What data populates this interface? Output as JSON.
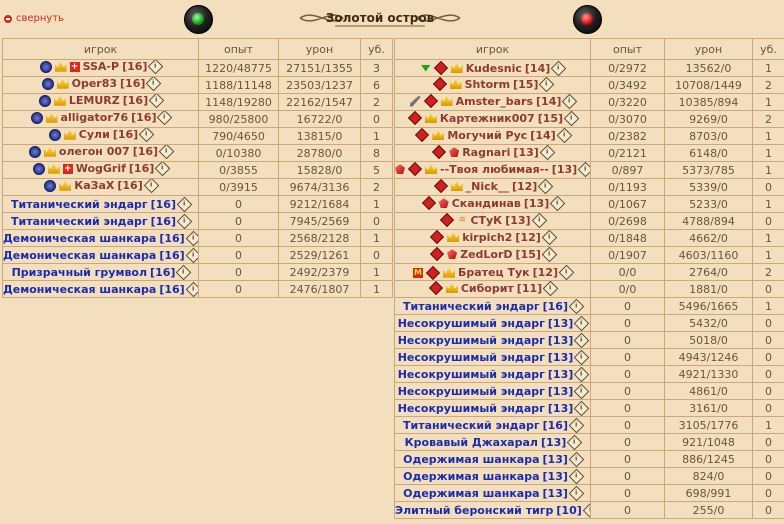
{
  "collapse_label": "свернуть",
  "title": "Золотой остров",
  "headers": {
    "player": "игрок",
    "exp": "опыт",
    "dmg": "урон",
    "kills": "уб."
  },
  "left_team": [
    {
      "name": "SSA-P",
      "level": "[16]",
      "exp": "1220/48775",
      "dmg": "27151/1355",
      "kills": "3",
      "bot": false,
      "icons": [
        "align-circle",
        "crown",
        "badge-plus",
        "info"
      ]
    },
    {
      "name": "Oper83",
      "level": "[16]",
      "exp": "1188/11148",
      "dmg": "23503/1237",
      "kills": "6",
      "bot": false,
      "icons": [
        "align-circle",
        "crown",
        "info"
      ]
    },
    {
      "name": "LEMURZ",
      "level": "[16]",
      "exp": "1148/19280",
      "dmg": "22162/1547",
      "kills": "2",
      "bot": false,
      "icons": [
        "align-circle",
        "crown",
        "info"
      ]
    },
    {
      "name": "alligator76",
      "level": "[16]",
      "exp": "980/25800",
      "dmg": "16722/0",
      "kills": "0",
      "bot": false,
      "icons": [
        "align-circle",
        "crown",
        "info"
      ]
    },
    {
      "name": "Сули",
      "level": "[16]",
      "exp": "790/4650",
      "dmg": "13815/0",
      "kills": "1",
      "bot": false,
      "icons": [
        "align-circle",
        "crown",
        "info"
      ]
    },
    {
      "name": "олегон 007",
      "level": "[16]",
      "exp": "0/10380",
      "dmg": "28780/0",
      "kills": "8",
      "bot": false,
      "icons": [
        "align-circle",
        "crown",
        "info"
      ]
    },
    {
      "name": "WogGrif",
      "level": "[16]",
      "exp": "0/3855",
      "dmg": "15828/0",
      "kills": "5",
      "bot": false,
      "icons": [
        "align-circle",
        "crown",
        "badge-plus",
        "info"
      ]
    },
    {
      "name": "КаЗаХ",
      "level": "[16]",
      "exp": "0/3915",
      "dmg": "9674/3136",
      "kills": "2",
      "bot": false,
      "icons": [
        "align-circle",
        "crown",
        "info"
      ]
    },
    {
      "name": "Титанический эндарг",
      "level": "[16]",
      "exp": "0",
      "dmg": "9212/1684",
      "kills": "1",
      "bot": true,
      "icons": [
        "info"
      ]
    },
    {
      "name": "Титанический эндарг",
      "level": "[16]",
      "exp": "0",
      "dmg": "7945/2569",
      "kills": "0",
      "bot": true,
      "icons": [
        "info"
      ]
    },
    {
      "name": "Демоническая шанкара",
      "level": "[16]",
      "exp": "0",
      "dmg": "2568/2128",
      "kills": "1",
      "bot": true,
      "icons": [
        "info"
      ]
    },
    {
      "name": "Демоническая шанкара",
      "level": "[16]",
      "exp": "0",
      "dmg": "2529/1261",
      "kills": "0",
      "bot": true,
      "icons": [
        "info"
      ]
    },
    {
      "name": "Призрачный грумвол",
      "level": "[16]",
      "exp": "0",
      "dmg": "2492/2379",
      "kills": "1",
      "bot": true,
      "icons": [
        "info"
      ]
    },
    {
      "name": "Демоническая шанкара",
      "level": "[16]",
      "exp": "0",
      "dmg": "2476/1807",
      "kills": "1",
      "bot": true,
      "icons": [
        "info"
      ]
    }
  ],
  "right_team": [
    {
      "name": "Kudesnic",
      "level": "[14]",
      "exp": "0/2972",
      "dmg": "13562/0",
      "kills": "1",
      "bot": false,
      "icons": [
        "align-green",
        "align-diamond",
        "crown",
        "info"
      ]
    },
    {
      "name": "Shtorm",
      "level": "[15]",
      "exp": "0/3492",
      "dmg": "10708/1449",
      "kills": "2",
      "bot": false,
      "icons": [
        "align-diamond",
        "crown",
        "info"
      ]
    },
    {
      "name": "Amster_bars",
      "level": "[14]",
      "exp": "0/3220",
      "dmg": "10385/894",
      "kills": "1",
      "bot": false,
      "icons": [
        "brush",
        "align-diamond",
        "crown",
        "info"
      ]
    },
    {
      "name": "Картежник007",
      "level": "[15]",
      "exp": "0/3070",
      "dmg": "9269/0",
      "kills": "2",
      "bot": false,
      "icons": [
        "align-diamond",
        "crown",
        "info"
      ]
    },
    {
      "name": "Могучий Рус",
      "level": "[14]",
      "exp": "0/2382",
      "dmg": "8703/0",
      "kills": "1",
      "bot": false,
      "icons": [
        "align-diamond",
        "crown",
        "info"
      ]
    },
    {
      "name": "Ragnari",
      "level": "[13]",
      "exp": "0/2121",
      "dmg": "6148/0",
      "kills": "1",
      "bot": false,
      "icons": [
        "align-diamond",
        "gem-red",
        "info"
      ]
    },
    {
      "name": "--Твоя любимая--",
      "level": "[13]",
      "exp": "0/897",
      "dmg": "5373/785",
      "kills": "1",
      "bot": false,
      "icons": [
        "gem-red",
        "align-diamond",
        "crown",
        "info"
      ]
    },
    {
      "name": "_Nick__",
      "level": "[12]",
      "exp": "0/1193",
      "dmg": "5339/0",
      "kills": "0",
      "bot": false,
      "icons": [
        "align-diamond",
        "crown",
        "info"
      ]
    },
    {
      "name": "Скандинав",
      "level": "[13]",
      "exp": "0/1067",
      "dmg": "5233/0",
      "kills": "1",
      "bot": false,
      "icons": [
        "align-diamond",
        "gem-red",
        "info"
      ]
    },
    {
      "name": "СТуК",
      "level": "[13]",
      "exp": "0/2698",
      "dmg": "4788/894",
      "kills": "0",
      "bot": false,
      "icons": [
        "align-diamond",
        "wifi",
        "info"
      ]
    },
    {
      "name": "kirpich2",
      "level": "[12]",
      "exp": "0/1848",
      "dmg": "4662/0",
      "kills": "1",
      "bot": false,
      "icons": [
        "align-diamond",
        "crown",
        "info"
      ]
    },
    {
      "name": "ZedLorD",
      "level": "[15]",
      "exp": "0/1907",
      "dmg": "4603/1160",
      "kills": "1",
      "bot": false,
      "icons": [
        "align-diamond",
        "gem-red",
        "info"
      ]
    },
    {
      "name": "Братец Тук",
      "level": "[12]",
      "exp": "0/0",
      "dmg": "2764/0",
      "kills": "2",
      "bot": false,
      "icons": [
        "badge-m",
        "align-diamond",
        "crown",
        "info"
      ]
    },
    {
      "name": "Сиборит",
      "level": "[11]",
      "exp": "0/0",
      "dmg": "1881/0",
      "kills": "0",
      "bot": false,
      "icons": [
        "align-diamond",
        "crown",
        "info"
      ]
    },
    {
      "name": "Титанический эндарг",
      "level": "[16]",
      "exp": "0",
      "dmg": "5496/1665",
      "kills": "1",
      "bot": true,
      "icons": [
        "info"
      ]
    },
    {
      "name": "Несокрушимый эндарг",
      "level": "[13]",
      "exp": "0",
      "dmg": "5432/0",
      "kills": "0",
      "bot": true,
      "icons": [
        "info"
      ]
    },
    {
      "name": "Несокрушимый эндарг",
      "level": "[13]",
      "exp": "0",
      "dmg": "5018/0",
      "kills": "0",
      "bot": true,
      "icons": [
        "info"
      ]
    },
    {
      "name": "Несокрушимый эндарг",
      "level": "[13]",
      "exp": "0",
      "dmg": "4943/1246",
      "kills": "0",
      "bot": true,
      "icons": [
        "info"
      ]
    },
    {
      "name": "Несокрушимый эндарг",
      "level": "[13]",
      "exp": "0",
      "dmg": "4921/1330",
      "kills": "0",
      "bot": true,
      "icons": [
        "info"
      ]
    },
    {
      "name": "Несокрушимый эндарг",
      "level": "[13]",
      "exp": "0",
      "dmg": "4861/0",
      "kills": "0",
      "bot": true,
      "icons": [
        "info"
      ]
    },
    {
      "name": "Несокрушимый эндарг",
      "level": "[13]",
      "exp": "0",
      "dmg": "3161/0",
      "kills": "0",
      "bot": true,
      "icons": [
        "info"
      ]
    },
    {
      "name": "Титанический эндарг",
      "level": "[16]",
      "exp": "0",
      "dmg": "3105/1776",
      "kills": "1",
      "bot": true,
      "icons": [
        "info"
      ]
    },
    {
      "name": "Кровавый Джахарал",
      "level": "[13]",
      "exp": "0",
      "dmg": "921/1048",
      "kills": "0",
      "bot": true,
      "icons": [
        "info"
      ]
    },
    {
      "name": "Одержимая шанкара",
      "level": "[13]",
      "exp": "0",
      "dmg": "886/1245",
      "kills": "0",
      "bot": true,
      "icons": [
        "info"
      ]
    },
    {
      "name": "Одержимая шанкара",
      "level": "[13]",
      "exp": "0",
      "dmg": "824/0",
      "kills": "0",
      "bot": true,
      "icons": [
        "info"
      ]
    },
    {
      "name": "Одержимая шанкара",
      "level": "[13]",
      "exp": "0",
      "dmg": "698/991",
      "kills": "0",
      "bot": true,
      "icons": [
        "info"
      ]
    },
    {
      "name": "Элитный беронский тигр",
      "level": "[10]",
      "exp": "0",
      "dmg": "255/0",
      "kills": "0",
      "bot": true,
      "icons": [
        "info"
      ]
    }
  ]
}
